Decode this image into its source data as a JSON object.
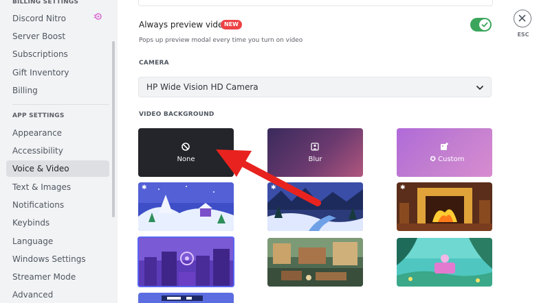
{
  "sidebar": {
    "billing_header": "BILLING SETTINGS",
    "billing_items": [
      {
        "label": "Discord Nitro"
      },
      {
        "label": "Server Boost"
      },
      {
        "label": "Subscriptions"
      },
      {
        "label": "Gift Inventory"
      },
      {
        "label": "Billing"
      }
    ],
    "app_header": "APP SETTINGS",
    "app_items": [
      {
        "label": "Appearance"
      },
      {
        "label": "Accessibility"
      },
      {
        "label": "Voice & Video",
        "active": true
      },
      {
        "label": "Text & Images"
      },
      {
        "label": "Notifications"
      },
      {
        "label": "Keybinds"
      },
      {
        "label": "Language"
      },
      {
        "label": "Windows Settings"
      },
      {
        "label": "Streamer Mode"
      },
      {
        "label": "Advanced"
      }
    ]
  },
  "preview": {
    "title": "Always preview video",
    "badge": "NEW",
    "description": "Pops up preview modal every time you turn on video",
    "enabled": true
  },
  "camera": {
    "label": "CAMERA",
    "selected": "HP Wide Vision HD Camera"
  },
  "background": {
    "label": "VIDEO BACKGROUND",
    "options": [
      {
        "label": "None",
        "icon": "block-icon"
      },
      {
        "label": "Blur",
        "icon": "blur-icon"
      },
      {
        "label": "Custom",
        "icon": "add-image-icon"
      }
    ]
  },
  "close": {
    "esc_label": "ESC"
  },
  "colors": {
    "accent": "#5865f2",
    "toggle_on": "#3ba55c",
    "badge": "#ed4245",
    "arrow": "#e8231f"
  }
}
